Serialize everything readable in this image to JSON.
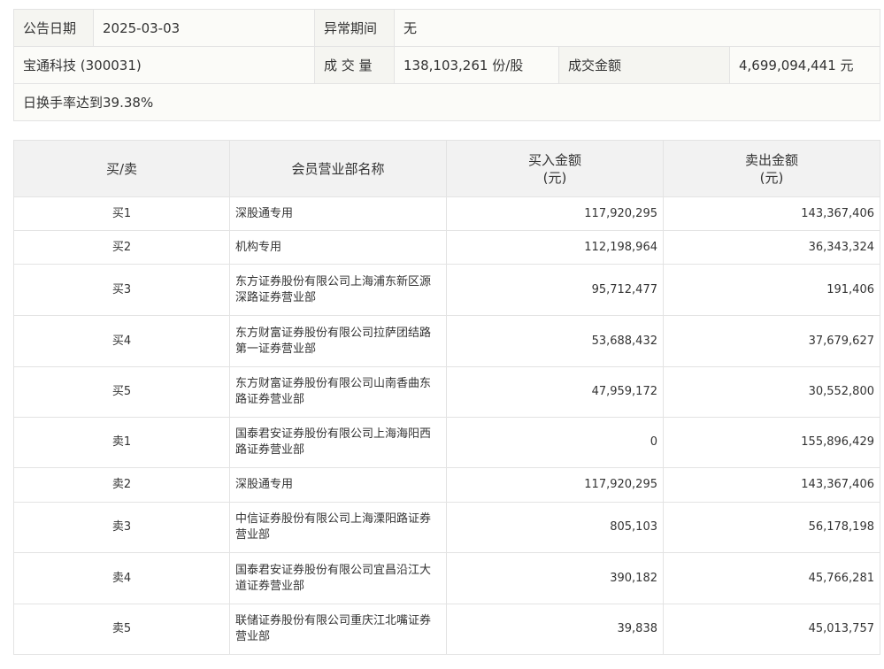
{
  "info": {
    "announce_date_label": "公告日期",
    "announce_date": "2025-03-03",
    "abnormal_period_label": "异常期间",
    "abnormal_period": "无",
    "stock_name": "宝通科技 (300031)",
    "volume_label": "成 交 量",
    "volume": "138,103,261 份/股",
    "turnover_label": "成交金额",
    "turnover": "4,699,094,441 元",
    "reason": "日换手率达到39.38%"
  },
  "table": {
    "headers": {
      "side": "买/卖",
      "branch": "会员营业部名称",
      "buy_amount": "买入金额",
      "buy_unit": "(元)",
      "sell_amount": "卖出金额",
      "sell_unit": "(元)"
    },
    "rows": [
      {
        "side": "买1",
        "branch": "深股通专用",
        "buy": "117,920,295",
        "sell": "143,367,406"
      },
      {
        "side": "买2",
        "branch": "机构专用",
        "buy": "112,198,964",
        "sell": "36,343,324"
      },
      {
        "side": "买3",
        "branch": "东方证券股份有限公司上海浦东新区源深路证券营业部",
        "buy": "95,712,477",
        "sell": "191,406"
      },
      {
        "side": "买4",
        "branch": "东方财富证券股份有限公司拉萨团结路第一证券营业部",
        "buy": "53,688,432",
        "sell": "37,679,627"
      },
      {
        "side": "买5",
        "branch": "东方财富证券股份有限公司山南香曲东路证券营业部",
        "buy": "47,959,172",
        "sell": "30,552,800"
      },
      {
        "side": "卖1",
        "branch": "国泰君安证券股份有限公司上海海阳西路证券营业部",
        "buy": "0",
        "sell": "155,896,429"
      },
      {
        "side": "卖2",
        "branch": "深股通专用",
        "buy": "117,920,295",
        "sell": "143,367,406"
      },
      {
        "side": "卖3",
        "branch": "中信证券股份有限公司上海溧阳路证券营业部",
        "buy": "805,103",
        "sell": "56,178,198"
      },
      {
        "side": "卖4",
        "branch": "国泰君安证券股份有限公司宜昌沿江大道证券营业部",
        "buy": "390,182",
        "sell": "45,766,281"
      },
      {
        "side": "卖5",
        "branch": "联储证券股份有限公司重庆江北嘴证券营业部",
        "buy": "39,838",
        "sell": "45,013,757"
      }
    ]
  }
}
